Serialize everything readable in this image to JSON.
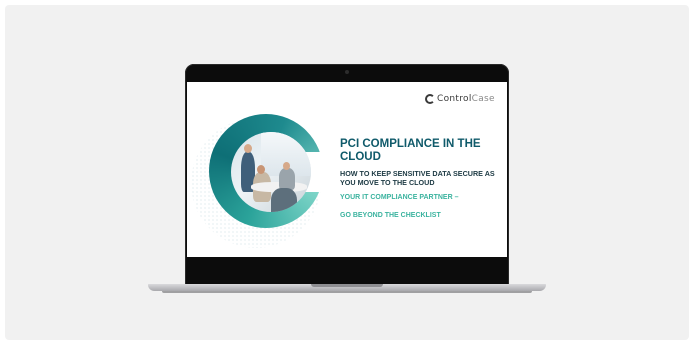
{
  "logo": {
    "text_main": "Control",
    "text_accent": "Case"
  },
  "slide": {
    "title": "PCI COMPLIANCE IN THE CLOUD",
    "subtitle": "HOW TO KEEP SENSITIVE DATA SECURE AS YOU MOVE TO THE CLOUD",
    "tagline_line1": "YOUR IT COMPLIANCE PARTNER –",
    "tagline_line2": "GO BEYOND THE CHECKLIST"
  },
  "colors": {
    "title": "#0f5a6a",
    "accent_teal": "#3bb39f",
    "ring_dark": "#0e6f76",
    "background": "#f1f1f1"
  },
  "icons": {
    "logo_mark": "c-ring-logo-icon"
  }
}
